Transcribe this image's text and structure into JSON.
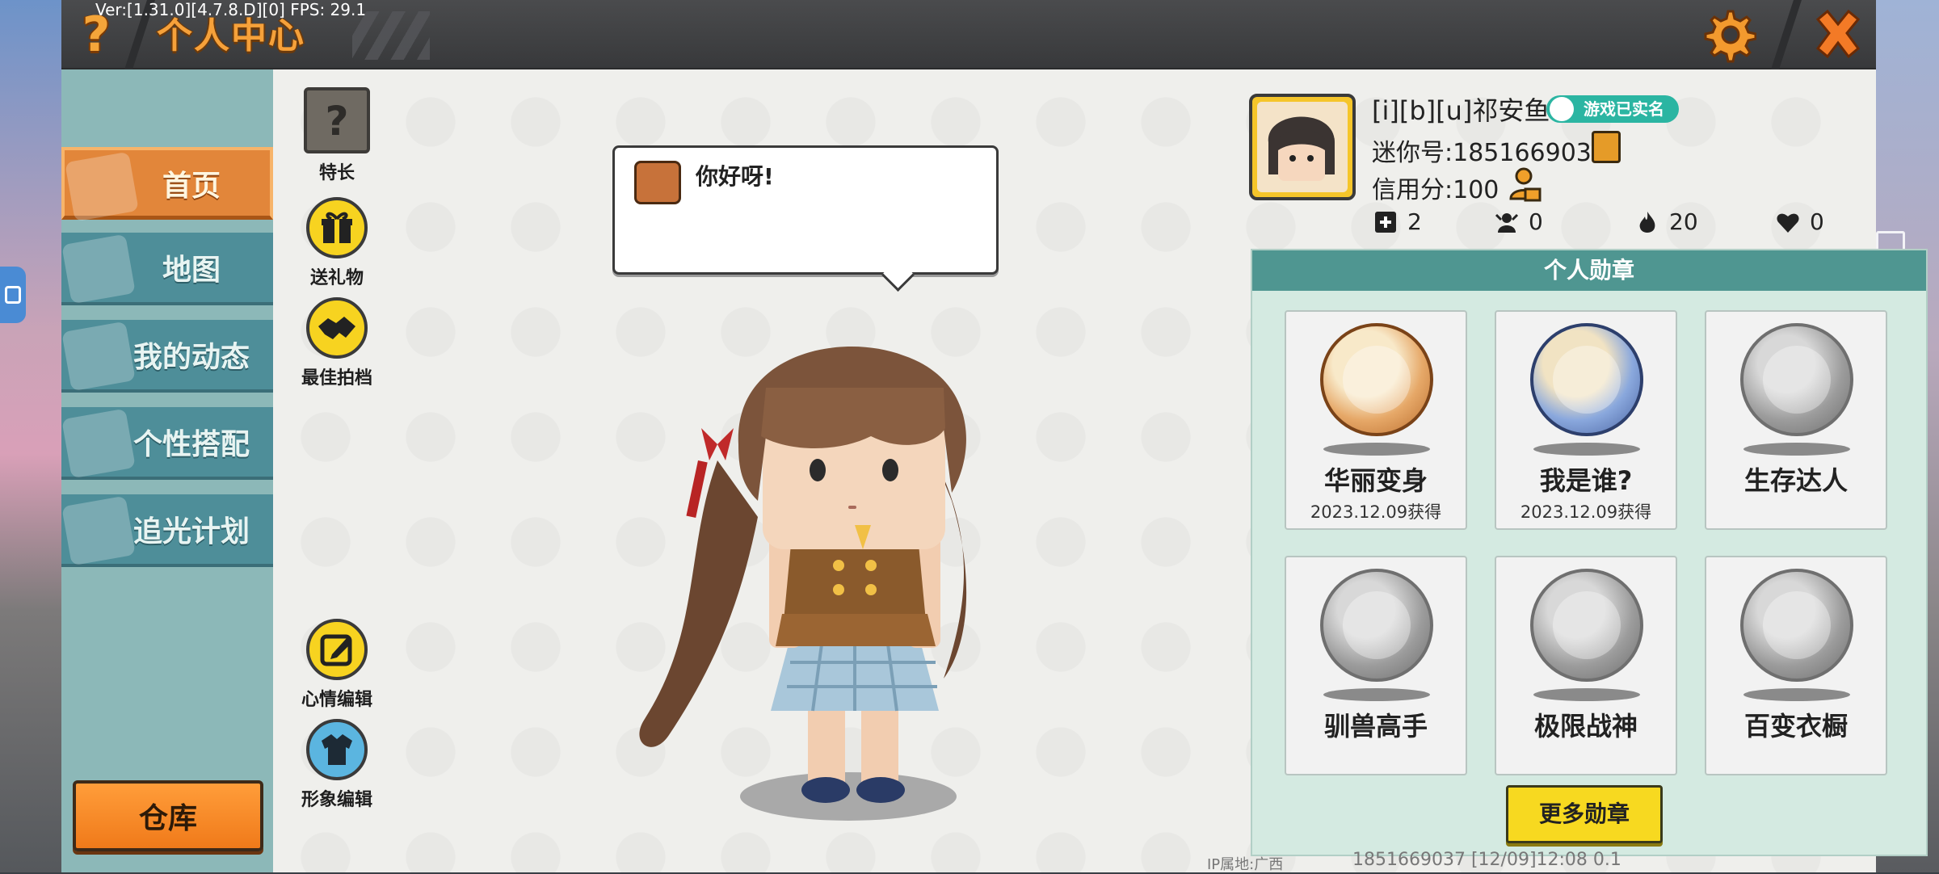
{
  "debug": {
    "fps_text": "Ver:[1.31.0][4.7.8.D][0] FPS: 29.1"
  },
  "topbar": {
    "title": "个人中心",
    "help_icon": "question-mark-icon",
    "settings_icon": "gear-icon",
    "close_icon": "close-icon"
  },
  "sidebar": {
    "items": [
      {
        "label": "首页",
        "icon": "home-icon",
        "active": true
      },
      {
        "label": "地图",
        "icon": "map-icon",
        "active": false
      },
      {
        "label": "我的动态",
        "icon": "bell-icon",
        "active": false
      },
      {
        "label": "个性搭配",
        "icon": "outfit-icon",
        "active": false
      },
      {
        "label": "追光计划",
        "icon": "light-plan-icon",
        "active": false
      }
    ],
    "warehouse_label": "仓库"
  },
  "actions": {
    "specialty": "特长",
    "gift": "送礼物",
    "best_photo": "最佳拍档",
    "mood_edit": "心情编辑",
    "avatar_edit": "形象编辑"
  },
  "bubble": {
    "text": "你好呀!"
  },
  "profile": {
    "username": "[i][b][u]祁安鱼",
    "realname_badge": "游戏已实名",
    "mini_id": "迷你号:1851669037",
    "credit": "信用分:100",
    "stats": [
      {
        "icon": "add-friend-icon",
        "value": "2"
      },
      {
        "icon": "fan-icon",
        "value": "0"
      },
      {
        "icon": "fire-icon",
        "value": "20"
      },
      {
        "icon": "heart-icon",
        "value": "0"
      }
    ]
  },
  "medals": {
    "header": "个人勋章",
    "items": [
      {
        "name": "华丽变身",
        "date": "2023.12.09获得",
        "style": "bronze"
      },
      {
        "name": "我是谁?",
        "date": "2023.12.09获得",
        "style": "blue"
      },
      {
        "name": "生存达人",
        "date": "",
        "style": "gray"
      },
      {
        "name": "驯兽高手",
        "date": "",
        "style": "gray"
      },
      {
        "name": "极限战神",
        "date": "",
        "style": "gray"
      },
      {
        "name": "百变衣橱",
        "date": "",
        "style": "gray"
      }
    ],
    "more_label": "更多勋章"
  },
  "footer": {
    "ip": "IP属地:广西",
    "info": "1851669037    [12/09]12:08 0.1"
  },
  "colors": {
    "accent_orange": "#f6a13a",
    "sidebar_teal": "#4e8e99",
    "medal_header": "#4f9691",
    "badge_green": "#2bb5a2"
  }
}
